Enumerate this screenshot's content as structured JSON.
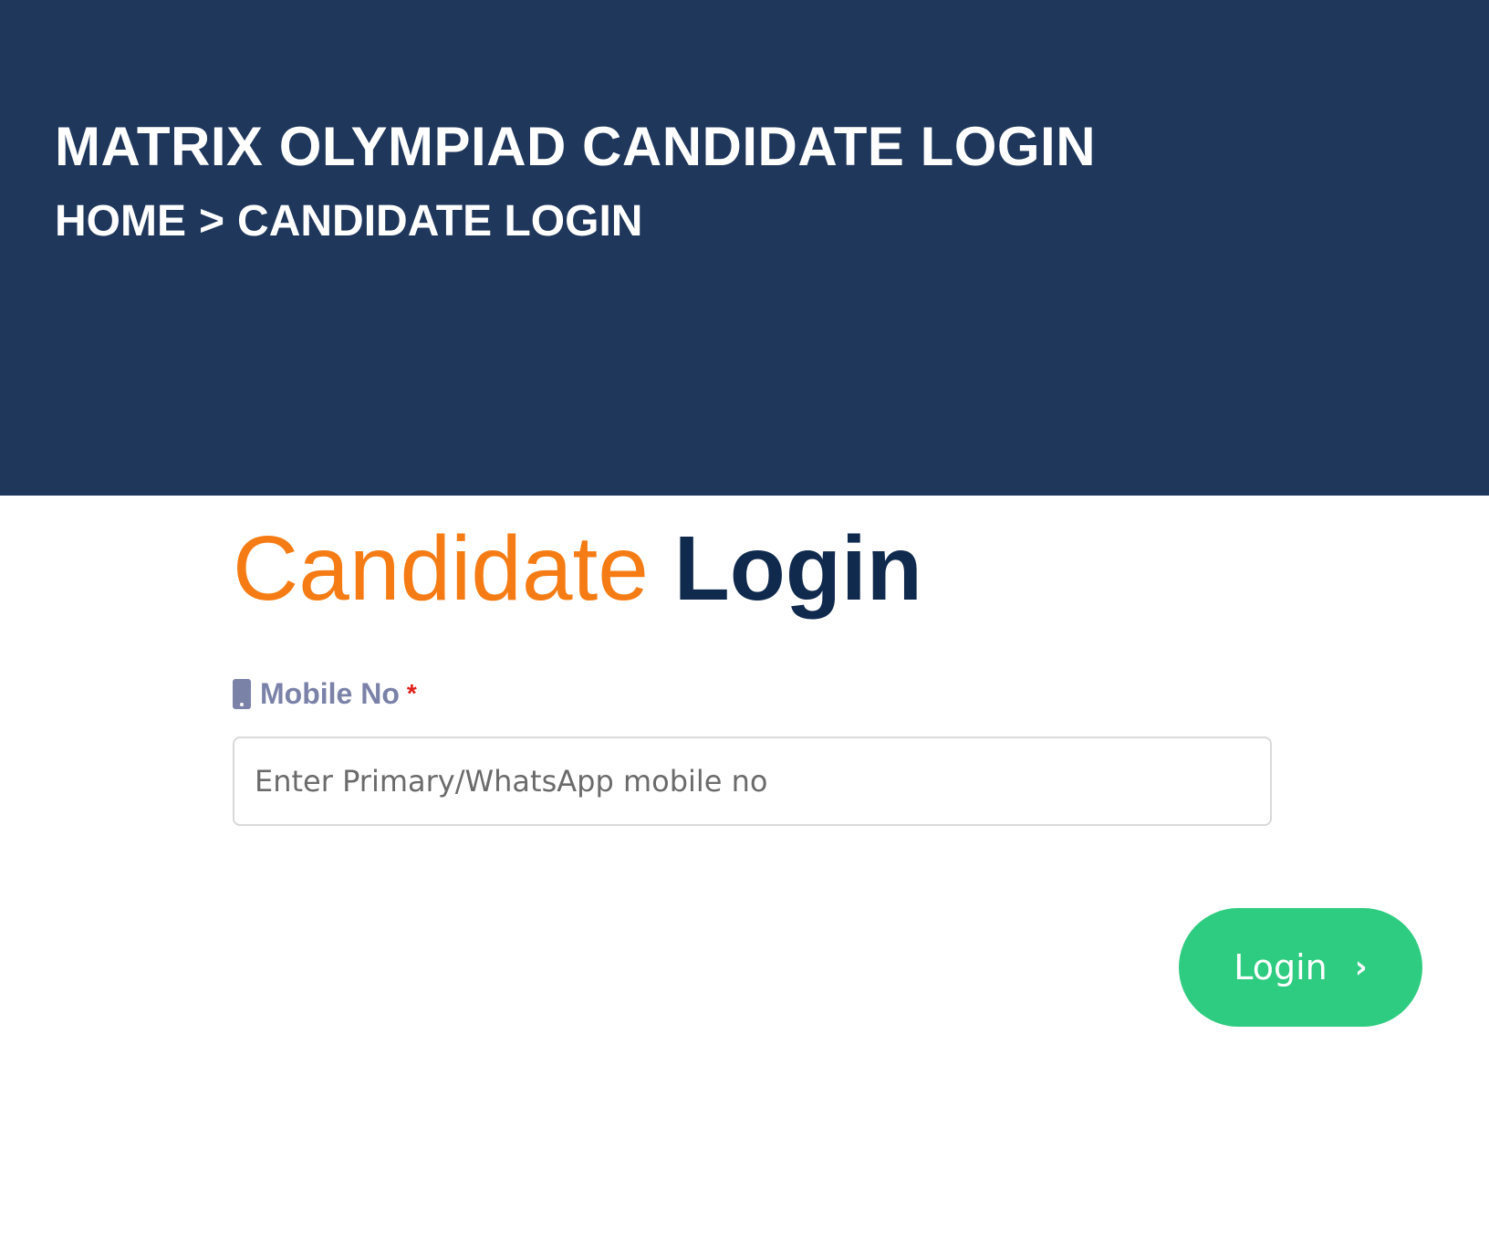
{
  "banner": {
    "title": "MATRIX OLYMPIAD CANDIDATE LOGIN",
    "breadcrumb": {
      "home": "HOME",
      "separator": ">",
      "current": "CANDIDATE LOGIN"
    }
  },
  "form": {
    "heading_light": "Candidate",
    "heading_bold": "Login",
    "mobile": {
      "label": "Mobile No",
      "required_mark": "*",
      "placeholder": "Enter Primary/WhatsApp mobile no",
      "value": "",
      "icon": "mobile-phone-icon"
    },
    "submit": {
      "label": "Login",
      "icon": "chevron-right-icon"
    }
  },
  "colors": {
    "banner_bg": "#1e375b",
    "heading_accent": "#f57c14",
    "heading_dark": "#0f2a4d",
    "label": "#7a82a8",
    "required": "#e0201b",
    "button_bg": "#2ecc80"
  }
}
